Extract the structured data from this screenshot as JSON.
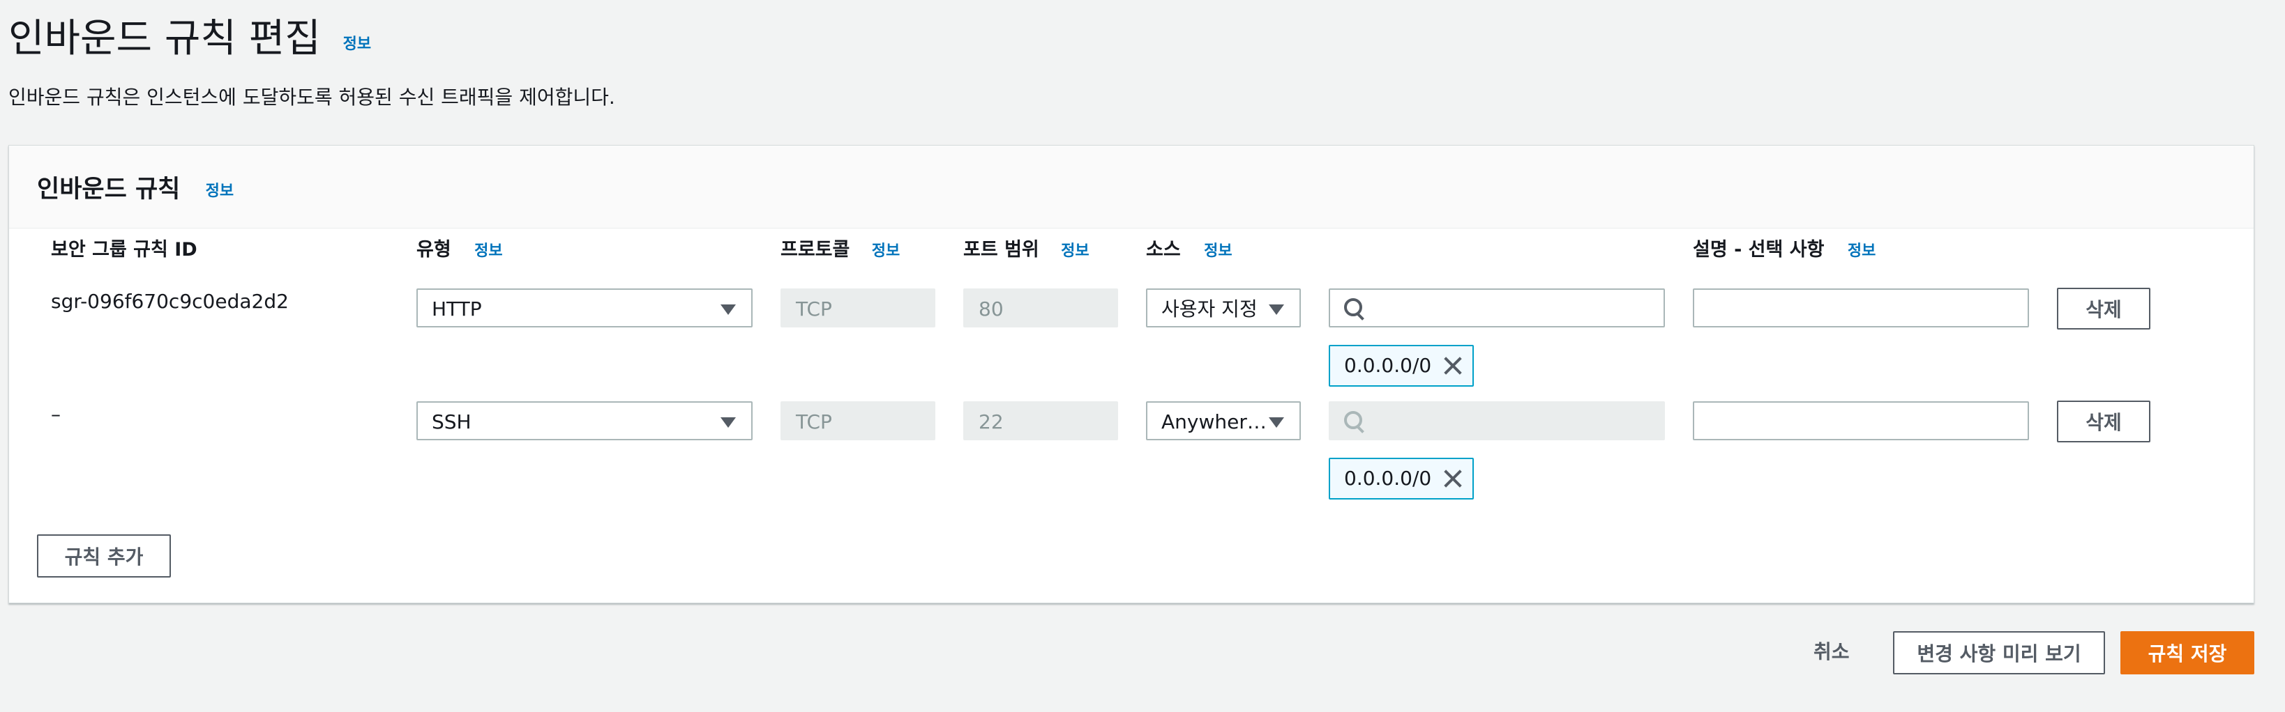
{
  "page": {
    "title": "인바운드 규칙 편집",
    "title_info": "정보",
    "description": "인바운드 규칙은 인스턴스에 도달하도록 허용된 수신 트래픽을 제어합니다."
  },
  "panel": {
    "title": "인바운드 규칙",
    "title_info": "정보",
    "columns": {
      "rule_id": "보안 그룹 규칙 ID",
      "type": "유형",
      "type_info": "정보",
      "protocol": "프로토콜",
      "protocol_info": "정보",
      "port_range": "포트 범위",
      "port_range_info": "정보",
      "source": "소스",
      "source_info": "정보",
      "description": "설명 - 선택 사항",
      "description_info": "정보"
    },
    "rules": [
      {
        "rule_id": "sgr-096f670c9c0eda2d2",
        "type": "HTTP",
        "protocol": "TCP",
        "port_range": "80",
        "source": "사용자 지정",
        "search_value": "",
        "search_enabled": true,
        "token": "0.0.0.0/0",
        "description_value": "",
        "delete_label": "삭제"
      },
      {
        "rule_id": "–",
        "type": "SSH",
        "protocol": "TCP",
        "port_range": "22",
        "source": "Anywher…",
        "search_value": "",
        "search_enabled": false,
        "token": "0.0.0.0/0",
        "description_value": "",
        "delete_label": "삭제"
      }
    ],
    "add_rule_label": "규칙 추가"
  },
  "footer": {
    "cancel_label": "취소",
    "preview_label": "변경 사항 미리 보기",
    "save_label": "규칙 저장"
  },
  "colors": {
    "accent": "#ec7211",
    "link": "#0073bb",
    "token_border": "#00a1c9"
  }
}
